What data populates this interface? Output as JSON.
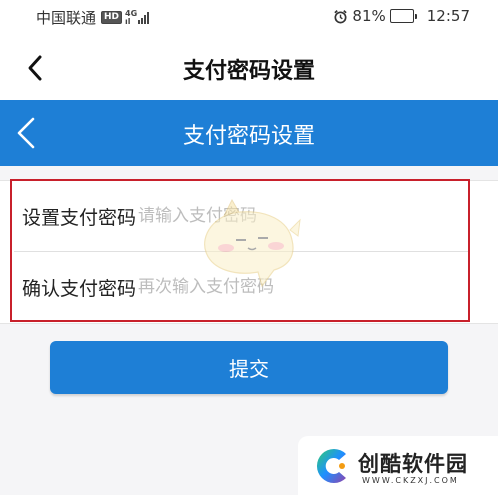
{
  "status_bar": {
    "carrier": "中国联通",
    "hd_badge": "HD",
    "network_type_top": "4G",
    "network_type_bottom": "ıl",
    "battery_percent": "81%",
    "time": "12:57",
    "battery_level": 0.81,
    "icons": [
      "alarm-icon",
      "battery-icon",
      "signal-icon"
    ]
  },
  "top_nav": {
    "title": "支付密码设置",
    "back_icon": "chevron-left-icon"
  },
  "app_nav": {
    "title": "支付密码设置",
    "back_icon": "chevron-left-icon"
  },
  "form": {
    "set_password": {
      "label": "设置支付密码",
      "placeholder": "请输入支付密码",
      "value": ""
    },
    "confirm_password": {
      "label": "确认支付密码",
      "placeholder": "再次输入支付密码",
      "value": ""
    }
  },
  "submit": {
    "label": "提交"
  },
  "watermark": {
    "name": "创酷软件园",
    "url": "WWW.CKZXJ.COM"
  },
  "colors": {
    "accent": "#1e7fd6",
    "highlight_box": "#c8202b",
    "placeholder": "#bdbdbd",
    "background": "#f5f5f7"
  }
}
